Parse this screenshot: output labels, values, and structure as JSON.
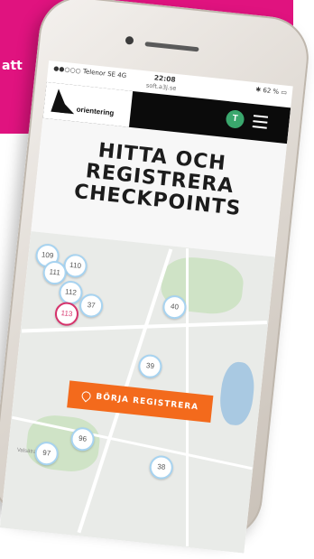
{
  "corner_word": "att",
  "statusbar": {
    "carrier": "●●○○○ Telenor SE  4G",
    "time": "22:08",
    "url": "soft.a3j.se",
    "battery": "✱ 62 % ▭"
  },
  "nav": {
    "logo_text": "orientering",
    "avatar_letter": "T"
  },
  "hero": {
    "line1": "HITTA OCH",
    "line2": "REGISTRERA",
    "line3": "CHECKPOINTS"
  },
  "map": {
    "pins": [
      "109",
      "110",
      "111",
      "112",
      "113",
      "37",
      "40",
      "39",
      "96",
      "97",
      "38"
    ],
    "active_pin": "113",
    "street_label": "Valsätra"
  },
  "cta": {
    "label": "BÖRJA REGISTRERA"
  },
  "colors": {
    "magenta": "#e0137f",
    "nav_black": "#0b0b0b",
    "cta_orange": "#f36a1c",
    "avatar_green": "#3aa76d",
    "active_pin": "#d6336c"
  }
}
